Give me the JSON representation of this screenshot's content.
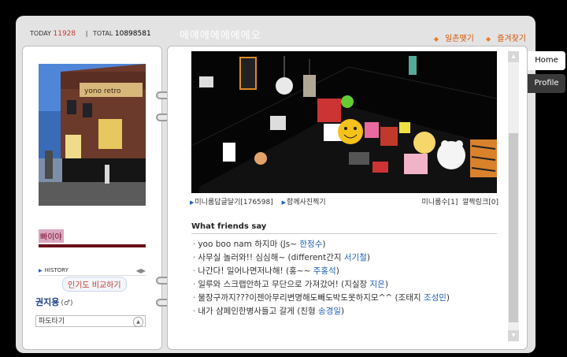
{
  "header": {
    "today_label": "TODAY",
    "today_count": "11928",
    "total_label": "TOTAL",
    "total_count": "10898581",
    "title": "에에에에에에에오",
    "link_random": "일촌맺기",
    "link_favorite": "즐겨찾기"
  },
  "profile": {
    "mood": "빠이야",
    "history_label": "HISTORY",
    "compare_button": "인기도 비교하기",
    "owner_name": "권지용",
    "owner_gender": "(♂)",
    "select_value": "파도타기",
    "shop_sign": "yono retro"
  },
  "miniroom": {
    "link_guestbook": "미니룸답글달기[176598]",
    "link_photo": "함께사진찍기",
    "visits": "미니룸수[1]",
    "links_count": "깔짝링크[0]"
  },
  "friends": {
    "heading": "What friends say",
    "items": [
      {
        "text": "yoo boo nam 하지마 (Js~ ",
        "author": "한정수",
        "tail": ")"
      },
      {
        "text": "사무실 놀러와!! 심심해~ (different간지 ",
        "author": "서기철",
        "tail": ")"
      },
      {
        "text": "나간다! 일어나면저나해! (홍~~ ",
        "author": "주홍석",
        "tail": ")"
      },
      {
        "text": "일루와 스크랩안하고 무단으로 가져갔어! (지실장 ",
        "author": "지은",
        "tail": ")"
      },
      {
        "text": "물장구까지???이젠아무리변명해도빼도박도못하지모^^ (조태지 ",
        "author": "조성민",
        "tail": ")"
      },
      {
        "text": "내가 샴페인한병사들고 갈게 (친형 ",
        "author": "송경일",
        "tail": ")"
      }
    ]
  },
  "tabs": {
    "home": "Home",
    "profile": "Profile"
  },
  "colors": {
    "accent_orange": "#d35400",
    "link_blue": "#1f5fb8",
    "mood_bar": "#6b0f1a",
    "today_red": "#c0392b"
  }
}
